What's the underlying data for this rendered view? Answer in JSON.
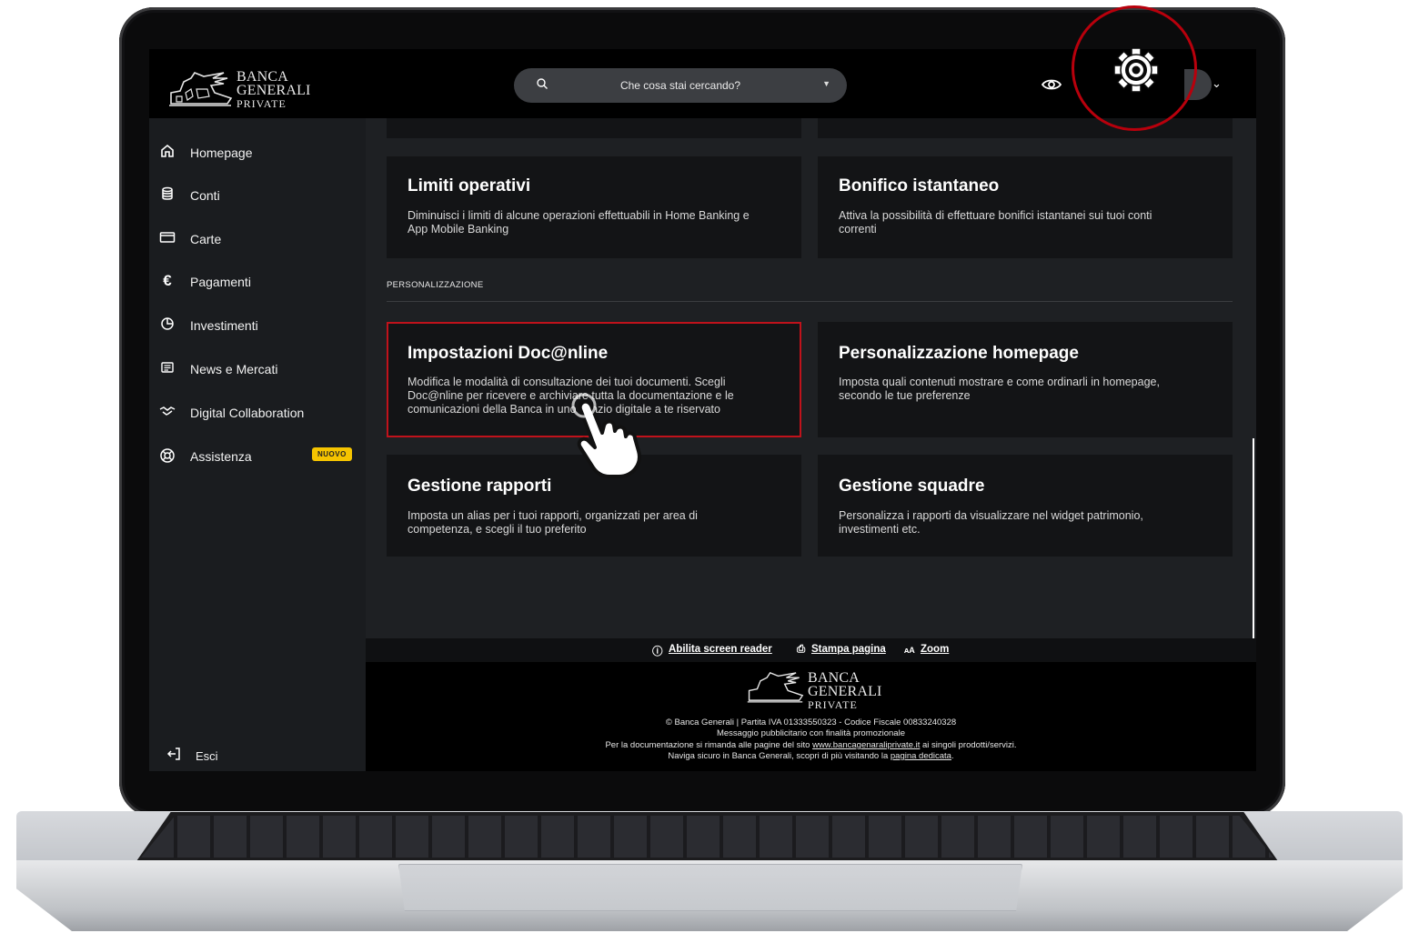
{
  "app": {
    "logo": {
      "line1": "BANCA",
      "line2": "GENERALI",
      "line3": "PRIVATE"
    },
    "search": {
      "placeholder": "Che cosa stai cercando?"
    }
  },
  "sidebar": {
    "items": [
      {
        "label": "Homepage",
        "icon": "home-icon"
      },
      {
        "label": "Conti",
        "icon": "database-icon"
      },
      {
        "label": "Carte",
        "icon": "card-icon"
      },
      {
        "label": "Pagamenti",
        "icon": "euro-icon"
      },
      {
        "label": "Investimenti",
        "icon": "pie-chart-icon"
      },
      {
        "label": "News e Mercati",
        "icon": "news-icon"
      },
      {
        "label": "Digital Collaboration",
        "icon": "handshake-icon"
      },
      {
        "label": "Assistenza",
        "icon": "lifebuoy-icon",
        "badge": "NUOVO"
      }
    ],
    "logout": {
      "label": "Esci",
      "icon": "logout-icon"
    }
  },
  "main": {
    "cards_top": [
      {
        "title": "Limiti operativi",
        "desc1": "Diminuisci i limiti di alcune operazioni effettuabili in Home Banking e",
        "desc2": "App Mobile Banking"
      },
      {
        "title": "Bonifico istantaneo",
        "desc1": "Attiva la possibilità di effettuare bonifici istantanei sui tuoi conti",
        "desc2": "correnti"
      }
    ],
    "section_title": "PERSONALIZZAZIONE",
    "cards": [
      {
        "title": "Impostazioni Doc@nline",
        "desc1": "Modifica le modalità di consultazione dei tuoi documenti. Scegli",
        "desc2": "Doc@nline per ricevere e archiviare tutta la documentazione e le",
        "desc3": "comunicazioni della Banca in uno spazio digitale a te riservato"
      },
      {
        "title": "Personalizzazione homepage",
        "desc1": "Imposta quali contenuti mostrare e come ordinarli in homepage,",
        "desc2": "secondo le tue preferenze"
      },
      {
        "title": "Gestione rapporti",
        "desc1": "Imposta un alias per i tuoi rapporti, organizzati per area di",
        "desc2": "competenza, e scegli il tuo preferito"
      },
      {
        "title": "Gestione squadre",
        "desc1": "Personalizza i rapporti da visualizzare nel widget patrimonio,",
        "desc2": "investimenti etc."
      }
    ]
  },
  "footer": {
    "links": {
      "screen_reader": "Abilita screen reader",
      "print": "Stampa pagina",
      "zoom": "Zoom",
      "zoom_prefix": "ᴀA"
    },
    "line1": "© Banca Generali | Partita IVA 01333550323 - Codice Fiscale 00833240328",
    "line2": "Messaggio pubblicitario con finalità promozionale",
    "line3_a": "Per la documentazione si rimanda alle pagine del sito",
    "line3_link": "www.bancagenaraliprivate.it",
    "line3_b": "ai singoli prodotti/servizi.",
    "line4_a": "Naviga sicuro in Banca Generali, scopri di più visitando la",
    "line4_link": "pagina dedicata",
    "line4_b": "."
  },
  "colors": {
    "highlight": "#c0121b",
    "badge": "#f5c400",
    "sidebar": "#1a1c1f",
    "card": "#131416"
  }
}
